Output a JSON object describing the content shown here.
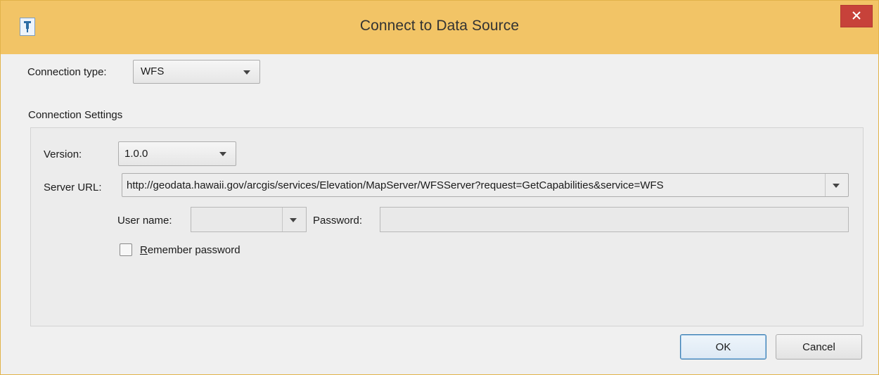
{
  "window": {
    "title": "Connect to Data Source",
    "icon": "pin-icon",
    "close_icon": "close-icon"
  },
  "connection_type": {
    "label": "Connection type:",
    "value": "WFS"
  },
  "settings": {
    "group_title": "Connection Settings",
    "version_label": "Version:",
    "version_value": "1.0.0",
    "server_url_label": "Server URL:",
    "server_url_value": "http://geodata.hawaii.gov/arcgis/services/Elevation/MapServer/WFSServer?request=GetCapabilities&service=WFS",
    "username_label": "User name:",
    "username_value": "",
    "password_label": "Password:",
    "password_value": "",
    "remember_label_underlined": "R",
    "remember_label_rest": "emember password",
    "remember_checked": false
  },
  "buttons": {
    "ok": "OK",
    "cancel": "Cancel"
  },
  "colors": {
    "titlebar": "#f2c466",
    "close_button": "#c7423a"
  }
}
